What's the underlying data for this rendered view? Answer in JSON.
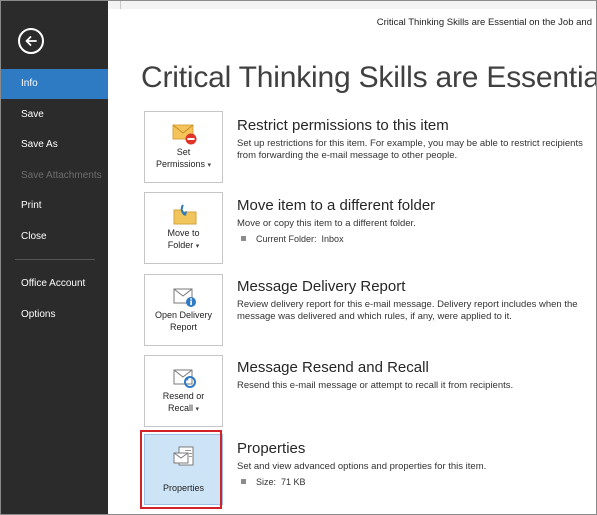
{
  "window": {
    "title": "Critical Thinking Skills are Essential on the Job and"
  },
  "page": {
    "title": "Critical Thinking Skills are Essential"
  },
  "sidebar": {
    "items": [
      {
        "label": "Info",
        "active": true
      },
      {
        "label": "Save"
      },
      {
        "label": "Save As"
      },
      {
        "label": "Save Attachments",
        "disabled": true
      },
      {
        "label": "Print"
      },
      {
        "label": "Close"
      },
      {
        "label": "Office Account"
      },
      {
        "label": "Options"
      }
    ]
  },
  "sections": {
    "restrict": {
      "tile_line1": "Set",
      "tile_line2": "Permissions",
      "caret": "▾",
      "title": "Restrict permissions to this item",
      "desc": "Set up restrictions for this item. For example, you may be able to restrict recipients from forwarding the e-mail message to other people."
    },
    "move": {
      "tile_line1": "Move to",
      "tile_line2": "Folder",
      "caret": "▾",
      "title": "Move item to a different folder",
      "desc": "Move or copy this item to a different folder.",
      "bullet_label": "Current Folder:",
      "bullet_value": "Inbox"
    },
    "delivery": {
      "tile_line1": "Open Delivery",
      "tile_line2": "Report",
      "title": "Message Delivery Report",
      "desc": "Review delivery report for this e-mail message. Delivery report includes when the message was delivered and which rules, if any, were applied to it."
    },
    "resend": {
      "tile_line1": "Resend or",
      "tile_line2": "Recall",
      "caret": "▾",
      "title": "Message Resend and Recall",
      "desc": "Resend this e-mail message or attempt to recall it from recipients."
    },
    "properties": {
      "tile_label": "Properties",
      "title": "Properties",
      "desc": "Set and view advanced options and properties for this item.",
      "bullet_label": "Size:",
      "bullet_value": "71 KB"
    }
  },
  "colors": {
    "sidebar_bg": "#2b2b2b",
    "active_bg": "#2e7ac3",
    "highlight_border": "#d2222a",
    "selected_tile_bg": "#cde3f6"
  }
}
